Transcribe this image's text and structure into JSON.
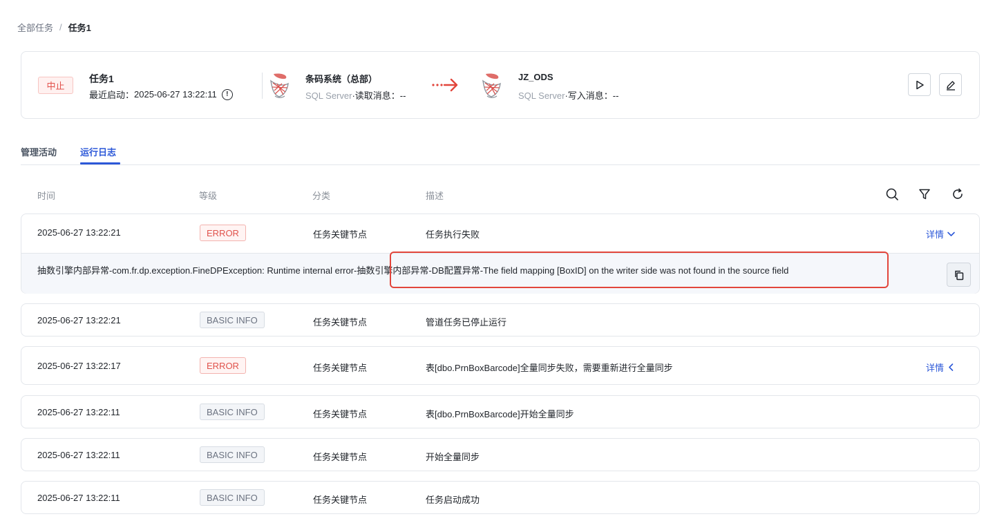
{
  "breadcrumb": {
    "root": "全部任务",
    "separator": "/",
    "current": "任务1"
  },
  "task": {
    "status": "中止",
    "name": "任务1",
    "last_start_label": "最近启动：",
    "last_start_time": "2025-06-27 13:22:11",
    "source": {
      "name": "条码系统（总部）",
      "type": "SQL Server",
      "sep": "·",
      "msg_label": "读取消息：",
      "msg_value": "--"
    },
    "target": {
      "name": "JZ_ODS",
      "type": "SQL Server",
      "sep": "·",
      "msg_label": "写入消息：",
      "msg_value": "--"
    }
  },
  "tabs": [
    {
      "label": "管理活动",
      "active": false
    },
    {
      "label": "运行日志",
      "active": true
    }
  ],
  "table": {
    "headers": {
      "time": "时间",
      "level": "等级",
      "category": "分类",
      "desc": "描述"
    },
    "tool_icons": [
      "search-icon",
      "filter-icon",
      "refresh-icon"
    ],
    "rows": [
      {
        "time": "2025-06-27 13:22:21",
        "level": "ERROR",
        "category": "任务关键节点",
        "desc": "任务执行失败",
        "detail": "详情",
        "expanded": true
      },
      {
        "time": "2025-06-27 13:22:21",
        "level": "BASIC INFO",
        "category": "任务关键节点",
        "desc": "管道任务已停止运行"
      },
      {
        "time": "2025-06-27 13:22:17",
        "level": "ERROR",
        "category": "任务关键节点",
        "desc": "表[dbo.PrnBoxBarcode]全量同步失败，需要重新进行全量同步",
        "detail": "详情",
        "expanded": false
      },
      {
        "time": "2025-06-27 13:22:11",
        "level": "BASIC INFO",
        "category": "任务关键节点",
        "desc": "表[dbo.PrnBoxBarcode]开始全量同步"
      },
      {
        "time": "2025-06-27 13:22:11",
        "level": "BASIC INFO",
        "category": "任务关键节点",
        "desc": "开始全量同步"
      },
      {
        "time": "2025-06-27 13:22:11",
        "level": "BASIC INFO",
        "category": "任务关键节点",
        "desc": "任务启动成功"
      }
    ],
    "expanded_detail": "抽数引擎内部异常-com.fr.dp.exception.FineDPException: Runtime internal error-抽数引擎内部异常-DB配置异常-The field mapping [BoxID] on the writer side was not found in the source field"
  },
  "colors": {
    "accent": "#2c58d8",
    "error": "#e0524b",
    "highlight": "#e2453b"
  }
}
